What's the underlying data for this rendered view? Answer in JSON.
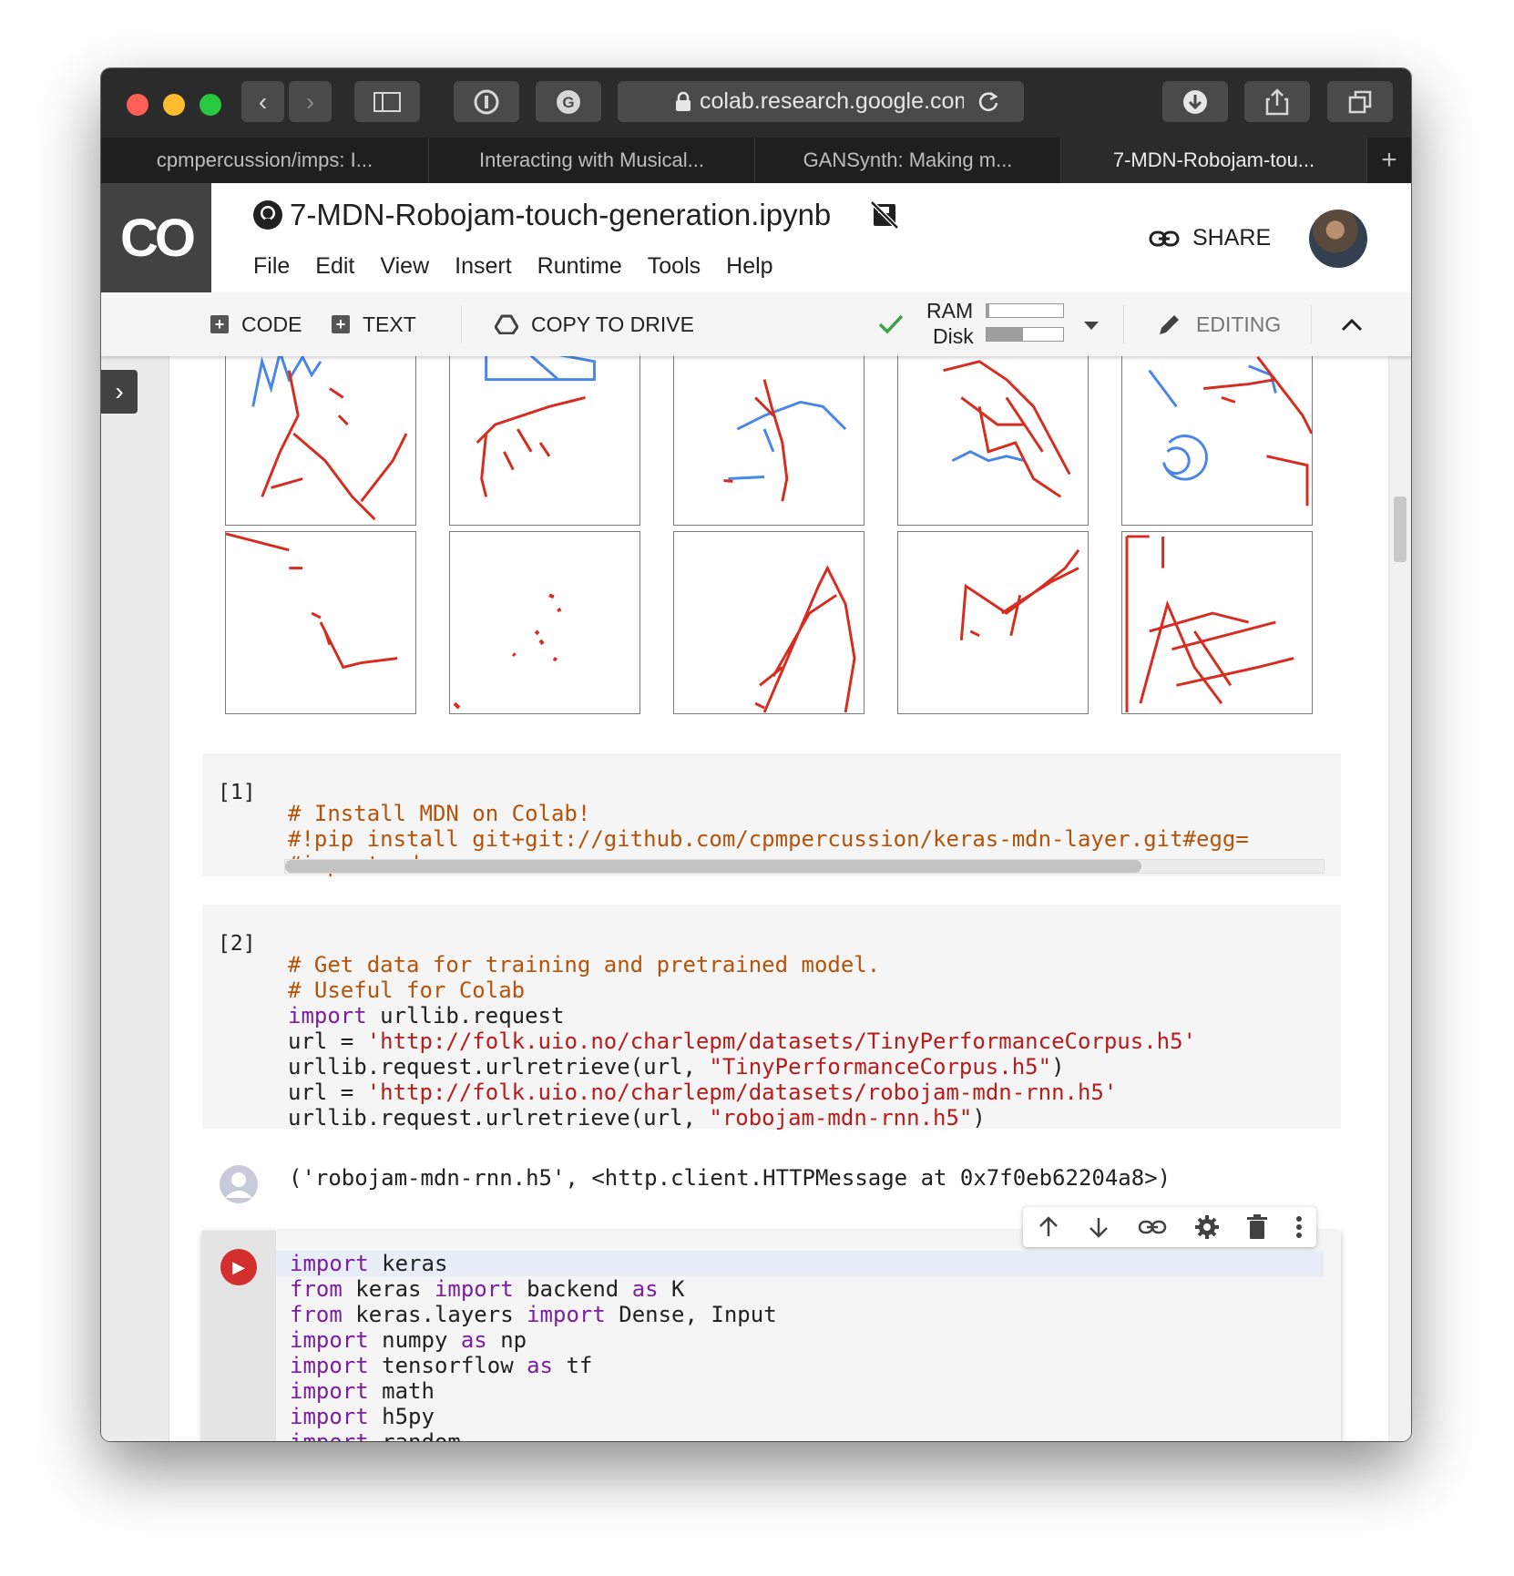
{
  "browser": {
    "url": "colab.research.google.com",
    "tabs": [
      "cpmpercussion/imps: I...",
      "Interacting with Musical...",
      "GANSynth: Making m...",
      "7-MDN-Robojam-tou..."
    ]
  },
  "header": {
    "notebook_title": "7-MDN-Robojam-touch-generation.ipynb",
    "menu": [
      "File",
      "Edit",
      "View",
      "Insert",
      "Runtime",
      "Tools",
      "Help"
    ],
    "share_label": "SHARE"
  },
  "toolbar": {
    "code_label": "CODE",
    "text_label": "TEXT",
    "copy_label": "COPY TO DRIVE",
    "ram_label": "RAM",
    "disk_label": "Disk",
    "ram_fraction": 0.03,
    "disk_fraction": 0.48,
    "editing_label": "EDITING"
  },
  "cells": [
    {
      "prompt": "[1]",
      "lines": [
        "# Install MDN on Colab!",
        "#!pip install git+git://github.com/cpmpercussion/keras-mdn-layer.git#egg=",
        "#import mdn"
      ]
    },
    {
      "prompt": "[2]",
      "lines": [
        "# Get data for training and pretrained model.",
        "# Useful for Colab",
        "import urllib.request",
        "url = 'http://folk.uio.no/charlepm/datasets/TinyPerformanceCorpus.h5'",
        "urllib.request.urlretrieve(url, \"TinyPerformanceCorpus.h5\")",
        "url = 'http://folk.uio.no/charlepm/datasets/robojam-mdn-rnn.h5'",
        "urllib.request.urlretrieve(url, \"robojam-mdn-rnn.h5\")"
      ],
      "output": "('robojam-mdn-rnn.h5', <http.client.HTTPMessage at 0x7f0eb62204a8>)"
    },
    {
      "prompt": "",
      "lines": [
        "import keras",
        "from keras import backend as K",
        "from keras.layers import Dense, Input",
        "import numpy as np",
        "import tensorflow as tf",
        "import math",
        "import h5py",
        "import random"
      ]
    }
  ],
  "colors": {
    "touch_red": "#d62d20",
    "touch_blue": "#4a86e8",
    "run_red": "#d32f2f"
  }
}
